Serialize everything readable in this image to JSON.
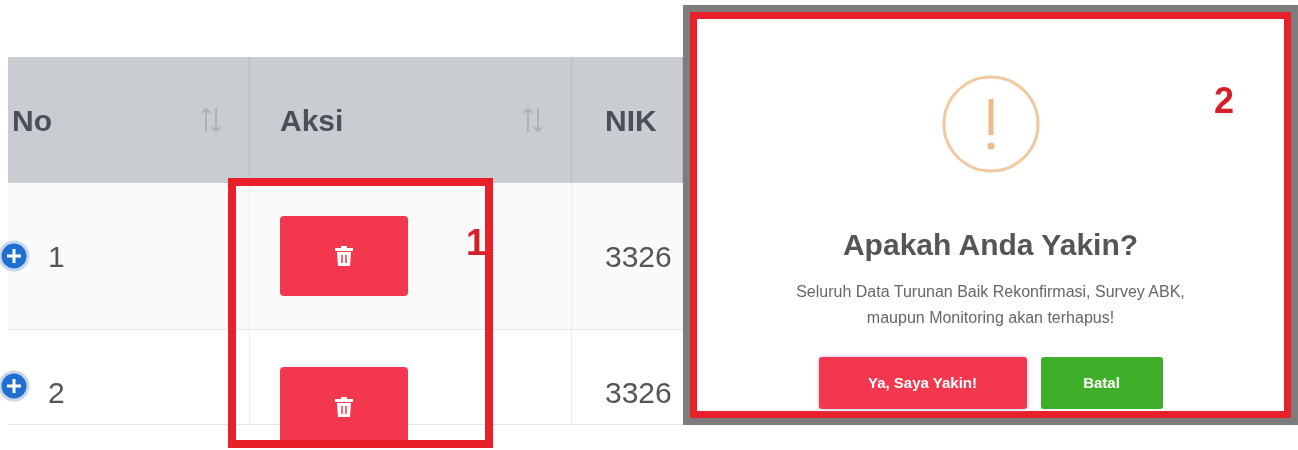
{
  "table": {
    "columns": [
      {
        "label": "No",
        "sortable": true
      },
      {
        "label": "Aksi",
        "sortable": true
      },
      {
        "label": "NIK"
      }
    ],
    "rows": [
      {
        "no": "1",
        "nik": "3326"
      },
      {
        "no": "2",
        "nik": "3326"
      }
    ]
  },
  "dialog": {
    "title": "Apakah Anda Yakin?",
    "message": "Seluruh Data Turunan Baik Rekonfirmasi, Survey ABK, maupun Monitoring akan terhapus!",
    "buttons": [
      {
        "label": "Ya, Saya Yakin!",
        "kind": "confirm"
      },
      {
        "label": "Batal",
        "kind": "cancel"
      }
    ]
  },
  "annotations": [
    {
      "label": "1"
    },
    {
      "label": "2"
    }
  ]
}
